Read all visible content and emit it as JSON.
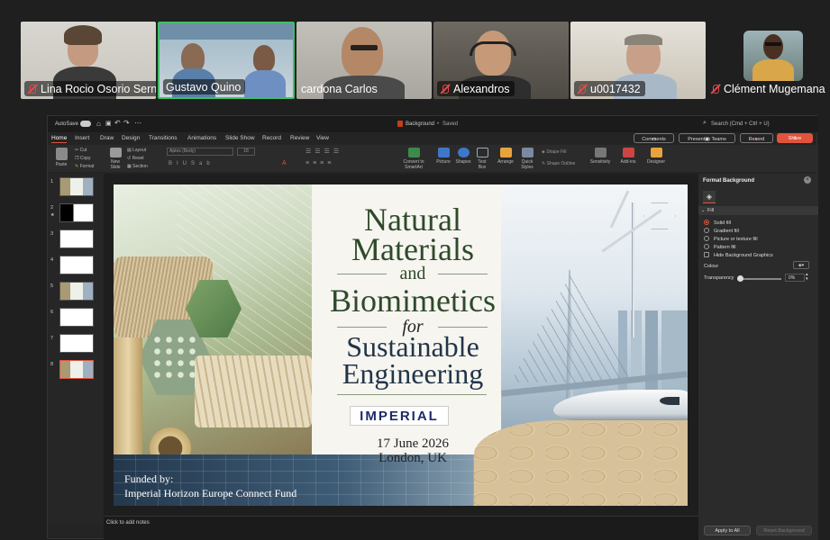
{
  "participants": [
    {
      "name": "Lina Rocio Osorio Serna",
      "muted": true
    },
    {
      "name": "Gustavo Quino",
      "muted": false,
      "speaking": true
    },
    {
      "name": "cardona Carlos",
      "muted": false
    },
    {
      "name": "Alexandros",
      "muted": true
    },
    {
      "name": "u0017432",
      "muted": true
    },
    {
      "name": "Clément Mugemana",
      "muted": true
    }
  ],
  "app": {
    "autosave_label": "AutoSave",
    "file_title": "Background",
    "saved_status": "Saved",
    "search_placeholder": "Search (Cmd + Ctrl + U)"
  },
  "ribbon_tabs": [
    "Home",
    "Insert",
    "Draw",
    "Design",
    "Transitions",
    "Animations",
    "Slide Show",
    "Record",
    "Review",
    "View"
  ],
  "active_tab": "Home",
  "ribbon_buttons": {
    "comments": "Comments",
    "present_in_teams": "Present in Teams",
    "record": "Record",
    "share": "Share"
  },
  "ribbon_items": {
    "paste": "Paste",
    "cut": "Cut",
    "copy": "Copy",
    "format": "Format",
    "new_slide": "New Slide",
    "layout": "Layout",
    "reset": "Reset",
    "section": "Section",
    "font_name": "Aptos (Body)",
    "font_size": "18",
    "convert_smartart": "Convert to SmartArt",
    "picture": "Picture",
    "shapes": "Shapes",
    "text_box": "Text Box",
    "arrange": "Arrange",
    "quick_styles": "Quick Styles",
    "shape_fill": "Shape Fill",
    "shape_outline": "Shape Outline",
    "sensitivity": "Sensitivity",
    "add_ins": "Add-ins",
    "designer": "Designer"
  },
  "slide_numbers": [
    "1",
    "2",
    "3",
    "4",
    "5",
    "6",
    "7",
    "8"
  ],
  "slide": {
    "title_l1": "Natural",
    "title_l2": "Materials",
    "title_and": "and",
    "title_l3": "Biomimetics",
    "title_for": "for",
    "title_l4": "Sustainable",
    "title_l5": "Engineering",
    "institution": "IMPERIAL",
    "date": "17 June 2026",
    "location": "London, UK",
    "funded_by": "Funded by:",
    "funder": "Imperial Horizon Europe Connect Fund"
  },
  "notes_placeholder": "Click to add notes",
  "format_pane": {
    "title": "Format Background",
    "section": "Fill",
    "options": [
      "Solid fill",
      "Gradient fill",
      "Picture or texture fill",
      "Pattern fill"
    ],
    "selected_option": "Solid fill",
    "hide_graphics": "Hide Background Graphics",
    "colour_label": "Colour",
    "transparency_label": "Transparency",
    "transparency_value": "0%",
    "apply_all": "Apply to All",
    "reset_background": "Reset Background"
  },
  "colors": {
    "accent": "#e0533d",
    "title_green": "#2f4a2a",
    "institution_navy": "#1d2a6b",
    "speaking_border": "#3fbf68"
  }
}
